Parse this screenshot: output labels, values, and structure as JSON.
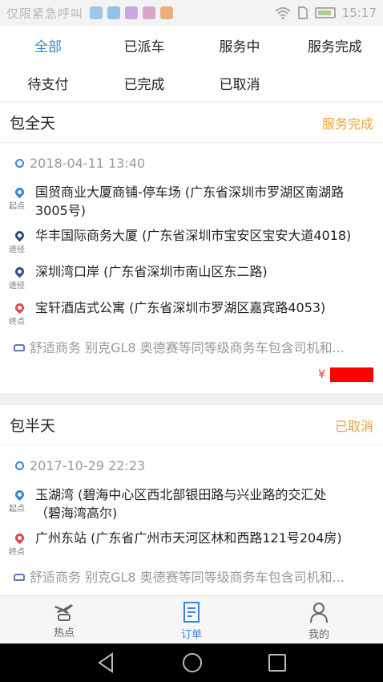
{
  "status_bar": {
    "carrier": "仅限紧急呼叫",
    "time": "15:17"
  },
  "tabs": [
    {
      "label": "全部",
      "active": true
    },
    {
      "label": "已派车"
    },
    {
      "label": "服务中"
    },
    {
      "label": "服务完成"
    },
    {
      "label": "待支付"
    },
    {
      "label": "已完成"
    },
    {
      "label": "已取消"
    }
  ],
  "orders": [
    {
      "type": "包全天",
      "status": "服务完成",
      "datetime": "2018-04-11 13:40",
      "stops": [
        {
          "tag": "起点",
          "text_line1": "国贸商业大厦商铺-停车场 (广东省深圳市罗湖区南湖路",
          "text_line2": "3005号)"
        },
        {
          "tag": "途径",
          "text_line1": "华丰国际商务大厦 (广东省深圳市宝安区宝安大道4018)"
        },
        {
          "tag": "途径",
          "text_line1": "深圳湾口岸 (广东省深圳市南山区东二路)"
        },
        {
          "tag": "终点",
          "text_line1": "宝轩酒店式公寓 (广东省深圳市罗湖区嘉宾路4053)"
        }
      ],
      "vehicle": "舒适商务 别克GL8 奥德赛等同等级商务车包含司机和...",
      "currency": "¥"
    },
    {
      "type": "包半天",
      "status": "已取消",
      "datetime": "2017-10-29 22:23",
      "stops": [
        {
          "tag": "起点",
          "text_line1": "玉湖湾 (碧海中心区西北部银田路与兴业路的交汇处",
          "text_line2": "（碧海湾高尔)"
        },
        {
          "tag": "终点",
          "text_line1": "广州东站 (广东省广州市天河区林和西路121号204房)"
        }
      ],
      "vehicle": "舒适商务 别克GL8 奥德赛等同等级商务车包含司机和..."
    }
  ],
  "bottom_nav": [
    {
      "label": "热点"
    },
    {
      "label": "订单",
      "active": true
    },
    {
      "label": "我的"
    }
  ],
  "colors": {
    "accent": "#3a85d6",
    "status_orange": "#f0a23a",
    "start_pin": "#3a85d6",
    "via_pin": "#2d4e86",
    "end_pin": "#e04848"
  }
}
